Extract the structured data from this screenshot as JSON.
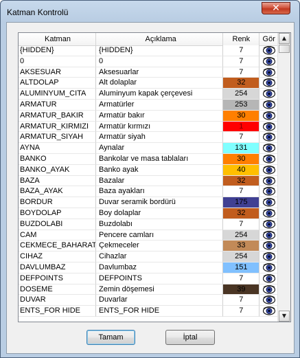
{
  "window": {
    "title": "Katman Kontrolü",
    "close_glyph": "✕"
  },
  "columns": [
    "Katman",
    "Açıklama",
    "Renk",
    "Gör"
  ],
  "rows": [
    {
      "layer": "{HIDDEN}",
      "desc": "{HIDDEN}",
      "color": "7",
      "bg": "#ffffff",
      "fg": "#000000"
    },
    {
      "layer": "0",
      "desc": "0",
      "color": "7",
      "bg": "#ffffff",
      "fg": "#000000"
    },
    {
      "layer": "AKSESUAR",
      "desc": "Aksesuarlar",
      "color": "7",
      "bg": "#ffffff",
      "fg": "#000000"
    },
    {
      "layer": "ALTDOLAP",
      "desc": "Alt dolaplar",
      "color": "32",
      "bg": "#c15d1e",
      "fg": "#000000"
    },
    {
      "layer": "ALUMINYUM_CITA",
      "desc": "Aluminyum kapak çerçevesi",
      "color": "254",
      "bg": "#d7d7d7",
      "fg": "#000000"
    },
    {
      "layer": "ARMATUR",
      "desc": "Armatürler",
      "color": "253",
      "bg": "#b6b6b6",
      "fg": "#000000"
    },
    {
      "layer": "ARMATUR_BAKIR",
      "desc": "Armatür bakır",
      "color": "30",
      "bg": "#ff7f00",
      "fg": "#000000"
    },
    {
      "layer": "ARMATUR_KIRMIZI",
      "desc": "Armatür kırmızı",
      "color": "1",
      "bg": "#ff0000",
      "fg": "#7f0000"
    },
    {
      "layer": "ARMATUR_SIYAH",
      "desc": "Armatür siyah",
      "color": "7",
      "bg": "#ffffff",
      "fg": "#000000"
    },
    {
      "layer": "AYNA",
      "desc": "Aynalar",
      "color": "131",
      "bg": "#80ffff",
      "fg": "#000000"
    },
    {
      "layer": "BANKO",
      "desc": "Bankolar ve masa tablaları",
      "color": "30",
      "bg": "#ff7f00",
      "fg": "#000000"
    },
    {
      "layer": "BANKO_AYAK",
      "desc": "Banko ayak",
      "color": "40",
      "bg": "#ffbf00",
      "fg": "#000000"
    },
    {
      "layer": "BAZA",
      "desc": "Bazalar",
      "color": "32",
      "bg": "#c15d1e",
      "fg": "#000000"
    },
    {
      "layer": "BAZA_AYAK",
      "desc": "Baza ayakları",
      "color": "7",
      "bg": "#ffffff",
      "fg": "#000000"
    },
    {
      "layer": "BORDUR",
      "desc": "Duvar seramik bordürü",
      "color": "175",
      "bg": "#404093",
      "fg": "#000000"
    },
    {
      "layer": "BOYDOLAP",
      "desc": "Boy dolaplar",
      "color": "32",
      "bg": "#c15d1e",
      "fg": "#000000"
    },
    {
      "layer": "BUZDOLABI",
      "desc": "Buzdolabı",
      "color": "7",
      "bg": "#ffffff",
      "fg": "#000000"
    },
    {
      "layer": "CAM",
      "desc": "Pencere camları",
      "color": "254",
      "bg": "#d7d7d7",
      "fg": "#000000"
    },
    {
      "layer": "CEKMECE_BAHARATL",
      "desc": "Çekmeceler",
      "color": "33",
      "bg": "#c28a58",
      "fg": "#000000"
    },
    {
      "layer": "CIHAZ",
      "desc": "Cihazlar",
      "color": "254",
      "bg": "#d7d7d7",
      "fg": "#000000"
    },
    {
      "layer": "DAVLUMBAZ",
      "desc": "Davlumbaz",
      "color": "151",
      "bg": "#80c0ff",
      "fg": "#000000"
    },
    {
      "layer": "DEFPOINTS",
      "desc": "DEFPOINTS",
      "color": "7",
      "bg": "#ffffff",
      "fg": "#000000"
    },
    {
      "layer": "DOSEME",
      "desc": "Zemin döşemesi",
      "color": "39",
      "bg": "#4a3524",
      "fg": "#000000"
    },
    {
      "layer": "DUVAR",
      "desc": "Duvarlar",
      "color": "7",
      "bg": "#ffffff",
      "fg": "#000000"
    },
    {
      "layer": "ENTS_FOR HIDE",
      "desc": "ENTS_FOR HIDE",
      "color": "7",
      "bg": "#ffffff",
      "fg": "#000000"
    }
  ],
  "scroll": {
    "up": "▲",
    "down": "▼",
    "position": 0.0
  },
  "buttons": {
    "ok": "Tamam",
    "cancel": "İptal"
  }
}
